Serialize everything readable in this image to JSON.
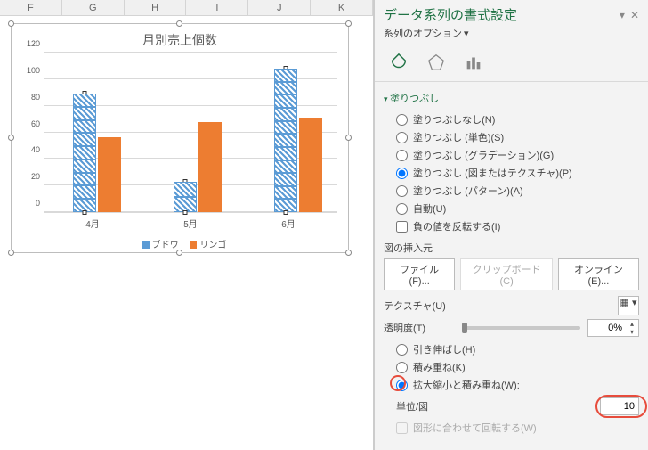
{
  "columns": [
    "F",
    "G",
    "H",
    "I",
    "J",
    "K"
  ],
  "chart_data": {
    "type": "bar",
    "title": "月別売上個数",
    "categories": [
      "4月",
      "5月",
      "6月"
    ],
    "series": [
      {
        "name": "ブドウ",
        "values": [
          89,
          23,
          108
        ],
        "color": "#5b9bd5"
      },
      {
        "name": "リンゴ",
        "values": [
          56,
          68,
          71
        ],
        "color": "#ed7d31"
      }
    ],
    "ylim": [
      0,
      120
    ],
    "ystep": 20
  },
  "panel": {
    "title": "データ系列の書式設定",
    "subtitle": "系列のオプション",
    "section": "塗りつぶし",
    "fill": {
      "none": "塗りつぶしなし(N)",
      "solid": "塗りつぶし (単色)(S)",
      "grad": "塗りつぶし (グラデーション)(G)",
      "pic": "塗りつぶし (図またはテクスチャ)(P)",
      "pat": "塗りつぶし (パターン)(A)",
      "auto": "自動(U)",
      "neg": "負の値を反転する(I)"
    },
    "insert": {
      "label": "図の挿入元",
      "file": "ファイル(F)...",
      "clip": "クリップボード(C)",
      "online": "オンライン(E)..."
    },
    "texture": "テクスチャ(U)",
    "transparency": {
      "label": "透明度(T)",
      "value": "0%"
    },
    "stretch": {
      "stretch": "引き伸ばし(H)",
      "stack": "積み重ね(K)",
      "stackscale": "拡大縮小と積み重ね(W):"
    },
    "unit": {
      "label": "単位/図",
      "value": "10"
    },
    "rotate": "図形に合わせて回転する(W)"
  }
}
